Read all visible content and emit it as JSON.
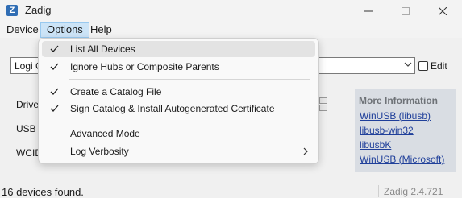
{
  "window": {
    "title": "Zadig",
    "app_icon_glyph": "Z"
  },
  "menubar": {
    "device": "Device",
    "options": "Options",
    "help": "Help"
  },
  "options_menu": {
    "items": [
      {
        "label": "List All Devices",
        "checked": true
      },
      {
        "label": "Ignore Hubs or Composite Parents",
        "checked": true
      },
      {
        "label": "Create a Catalog File",
        "checked": true
      },
      {
        "label": "Sign Catalog & Install Autogenerated Certificate",
        "checked": true
      },
      {
        "label": "Advanced Mode",
        "checked": false
      },
      {
        "label": "Log Verbosity",
        "checked": false,
        "submenu": true
      }
    ]
  },
  "main": {
    "device_combo_value": "Logi C",
    "edit_label": "Edit",
    "driver_label": "Driver",
    "usbid_label": "USB ID",
    "wcid_label": "WCID"
  },
  "info": {
    "title": "More Information",
    "links": [
      "WinUSB (libusb)",
      "libusb-win32",
      "libusbK",
      "WinUSB (Microsoft)"
    ]
  },
  "status": {
    "text": "16 devices found.",
    "version": "Zadig 2.4.721"
  },
  "colors": {
    "menu_highlight": "#cce4f7",
    "link": "#1f3f9a",
    "info_panel_bg": "#d9dde3"
  },
  "icons": {
    "app": "zadig-app-icon",
    "minimize": "minimize-icon",
    "maximize": "maximize-icon",
    "close": "close-icon",
    "check": "checkmark-icon",
    "submenu": "chevron-right-icon",
    "combo": "chevron-down-icon"
  }
}
